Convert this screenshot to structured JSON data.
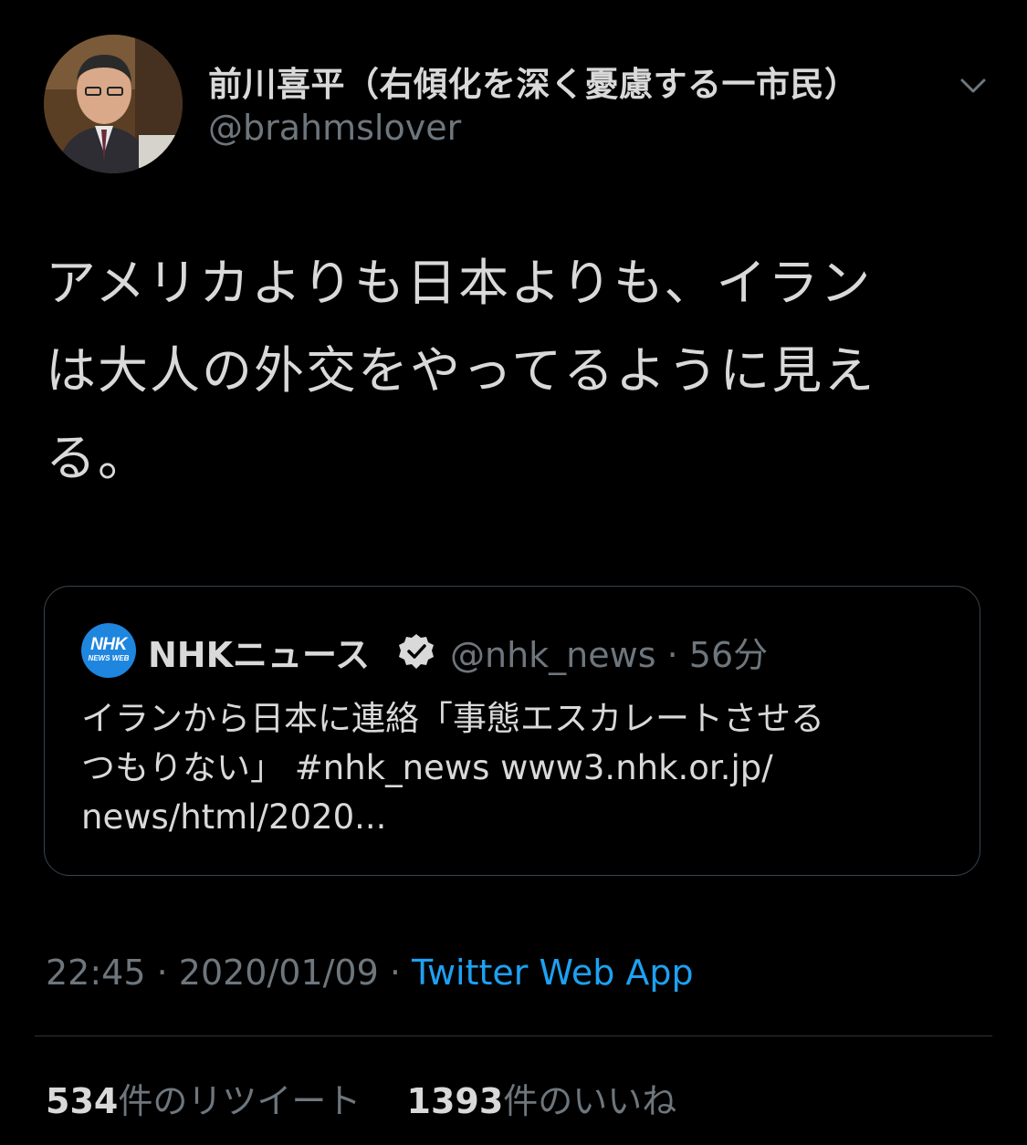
{
  "author": {
    "display_name": "前川喜平（右傾化を深く憂慮する一市民）",
    "handle": "@brahmslover",
    "avatar_icon": "profile-photo"
  },
  "tweet": {
    "text_lines": [
      "アメリカよりも日本よりも、イラン",
      "は大人の外交をやってるように見え",
      "る。"
    ]
  },
  "quoted_tweet": {
    "logo_text": "NHK",
    "logo_subtext": "NEWS WEB",
    "name": "NHKニュース",
    "verified_icon": "verified-badge-icon",
    "handle": "@nhk_news",
    "separator": "·",
    "time": "56分",
    "text_lines": [
      "イランから日本に連絡「事態エスカレートさせる",
      "つもりない」 #nhk_news www3.nhk.or.jp/",
      "news/html/2020..."
    ]
  },
  "meta": {
    "time": "22:45",
    "separator": " · ",
    "date": "2020/01/09",
    "source": "Twitter Web App"
  },
  "stats": {
    "retweet_count": "534",
    "retweet_label": "件のリツイート",
    "like_count": "1393",
    "like_label": "件のいいね"
  },
  "colors": {
    "background": "#000000",
    "text": "#d9d9d9",
    "secondary": "#6e767d",
    "link": "#1da1f2",
    "border": "#38444d",
    "nhk_blue": "#1f86e0"
  }
}
